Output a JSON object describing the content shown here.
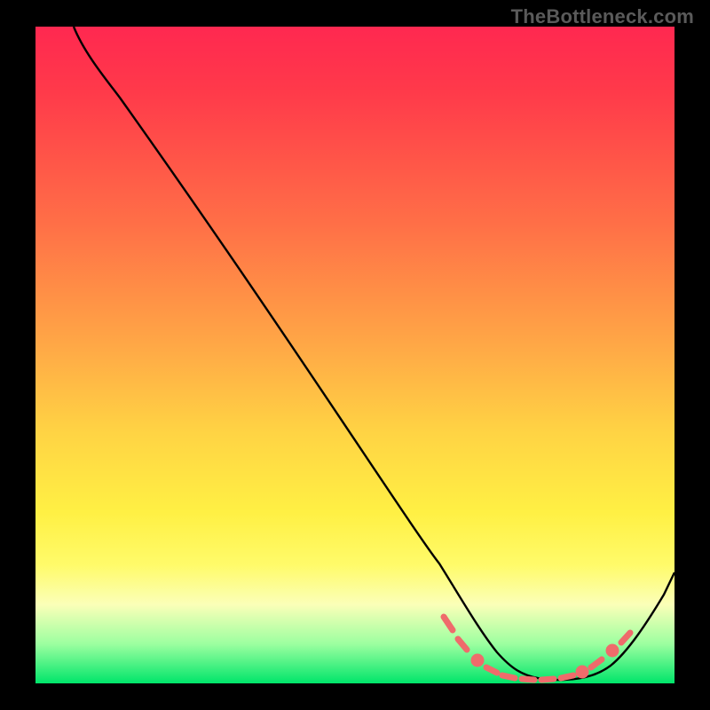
{
  "watermark": "TheBottleneck.com",
  "chart_data": {
    "type": "line",
    "title": "",
    "xlabel": "",
    "ylabel": "",
    "xlim": [
      0,
      100
    ],
    "ylim": [
      0,
      100
    ],
    "grid": false,
    "legend": false,
    "series": [
      {
        "name": "curve",
        "color": "#000000",
        "x": [
          6,
          10,
          15,
          20,
          25,
          30,
          35,
          40,
          45,
          50,
          55,
          60,
          63,
          66,
          70,
          74,
          78,
          82,
          86,
          90,
          94,
          98,
          100
        ],
        "y": [
          100,
          96,
          90,
          83,
          76,
          69,
          62,
          55,
          48,
          41,
          33,
          25,
          18,
          12,
          6,
          2,
          0,
          0,
          0,
          2,
          6,
          13,
          19
        ]
      }
    ],
    "markers": [
      {
        "name": "highlight-dots",
        "color": "#f16a6a",
        "points": [
          {
            "x": 64,
            "y": 10
          },
          {
            "x": 66,
            "y": 6
          },
          {
            "x": 69,
            "y": 3
          },
          {
            "x": 72,
            "y": 1.5
          },
          {
            "x": 74,
            "y": 1
          },
          {
            "x": 76,
            "y": 0.5
          },
          {
            "x": 78,
            "y": 0.5
          },
          {
            "x": 80,
            "y": 0.5
          },
          {
            "x": 82,
            "y": 0.5
          },
          {
            "x": 84,
            "y": 1
          },
          {
            "x": 86,
            "y": 1.5
          },
          {
            "x": 89,
            "y": 3
          },
          {
            "x": 91,
            "y": 5
          },
          {
            "x": 93,
            "y": 7
          }
        ]
      }
    ],
    "background_gradient": {
      "top": "#ff2850",
      "mid": "#ffd444",
      "bottom": "#00e56a"
    }
  }
}
